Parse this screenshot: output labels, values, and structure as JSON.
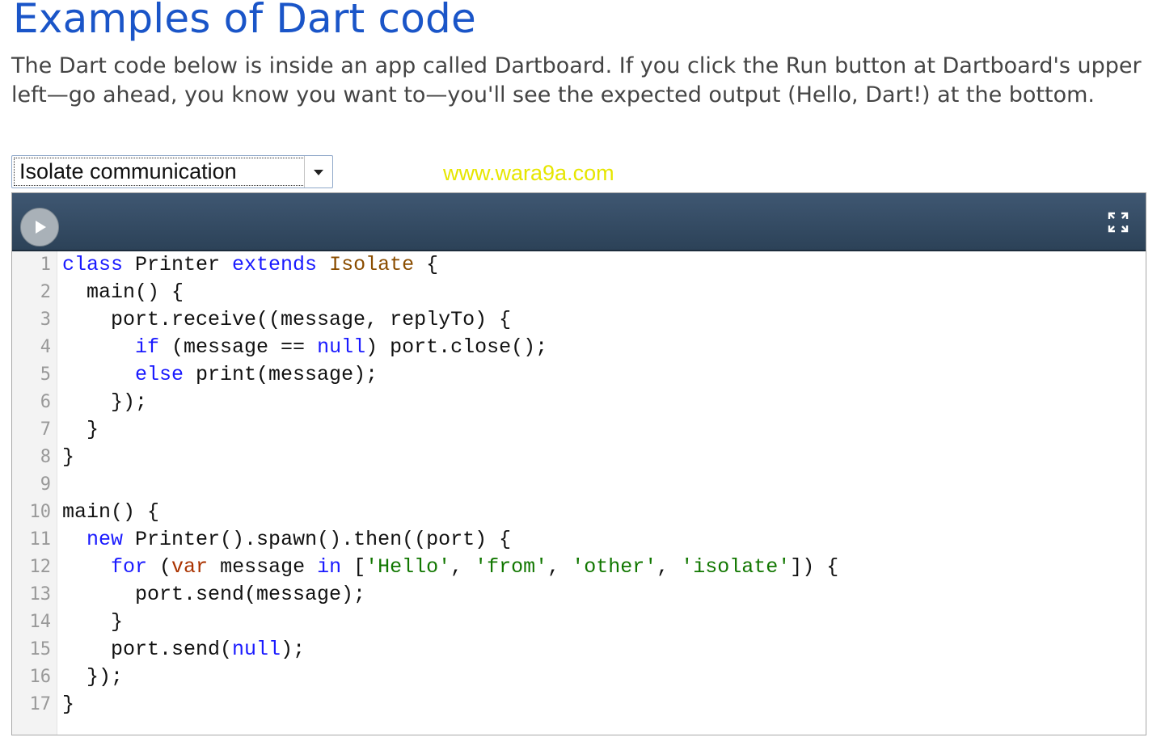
{
  "page": {
    "title": "Examples of Dart code",
    "intro": "The Dart code below is inside an app called Dartboard. If you click the Run button at Dartboard's upper left—go ahead, you know you want to—you'll see the expected output (Hello, Dart!) at the bottom."
  },
  "example_select": {
    "selected": "Isolate communication",
    "icon": "chevron-down-icon"
  },
  "watermark": "www.wara9a.com",
  "editor": {
    "toolbar_color": "#2f465e",
    "run_icon": "play-icon",
    "fullscreen_icon": "fullscreen-icon",
    "line_numbers": [
      "1",
      "2",
      "3",
      "4",
      "5",
      "6",
      "7",
      "8",
      "9",
      "10",
      "11",
      "12",
      "13",
      "14",
      "15",
      "16",
      "17"
    ],
    "lines": [
      [
        {
          "t": "class",
          "c": "kw"
        },
        {
          "t": " Printer "
        },
        {
          "t": "extends",
          "c": "kw"
        },
        {
          "t": " "
        },
        {
          "t": "Isolate",
          "c": "ty"
        },
        {
          "t": " {"
        }
      ],
      [
        {
          "t": "  main() {"
        }
      ],
      [
        {
          "t": "    port.receive((message, replyTo) {"
        }
      ],
      [
        {
          "t": "      "
        },
        {
          "t": "if",
          "c": "kw"
        },
        {
          "t": " (message == "
        },
        {
          "t": "null",
          "c": "kw"
        },
        {
          "t": ") port.close();"
        }
      ],
      [
        {
          "t": "      "
        },
        {
          "t": "else",
          "c": "kw"
        },
        {
          "t": " print(message);"
        }
      ],
      [
        {
          "t": "    });"
        }
      ],
      [
        {
          "t": "  }"
        }
      ],
      [
        {
          "t": "}"
        }
      ],
      [
        {
          "t": ""
        }
      ],
      [
        {
          "t": "main() {"
        }
      ],
      [
        {
          "t": "  "
        },
        {
          "t": "new",
          "c": "kw"
        },
        {
          "t": " Printer().spawn().then((port) {"
        }
      ],
      [
        {
          "t": "    "
        },
        {
          "t": "for",
          "c": "kw"
        },
        {
          "t": " ("
        },
        {
          "t": "var",
          "c": "vr"
        },
        {
          "t": " message "
        },
        {
          "t": "in",
          "c": "kw"
        },
        {
          "t": " ["
        },
        {
          "t": "'Hello'",
          "c": "str"
        },
        {
          "t": ", "
        },
        {
          "t": "'from'",
          "c": "str"
        },
        {
          "t": ", "
        },
        {
          "t": "'other'",
          "c": "str"
        },
        {
          "t": ", "
        },
        {
          "t": "'isolate'",
          "c": "str"
        },
        {
          "t": "]) {"
        }
      ],
      [
        {
          "t": "      port.send(message);"
        }
      ],
      [
        {
          "t": "    }"
        }
      ],
      [
        {
          "t": "    port.send("
        },
        {
          "t": "null",
          "c": "kw"
        },
        {
          "t": ");"
        }
      ],
      [
        {
          "t": "  });"
        }
      ],
      [
        {
          "t": "}"
        }
      ]
    ]
  }
}
